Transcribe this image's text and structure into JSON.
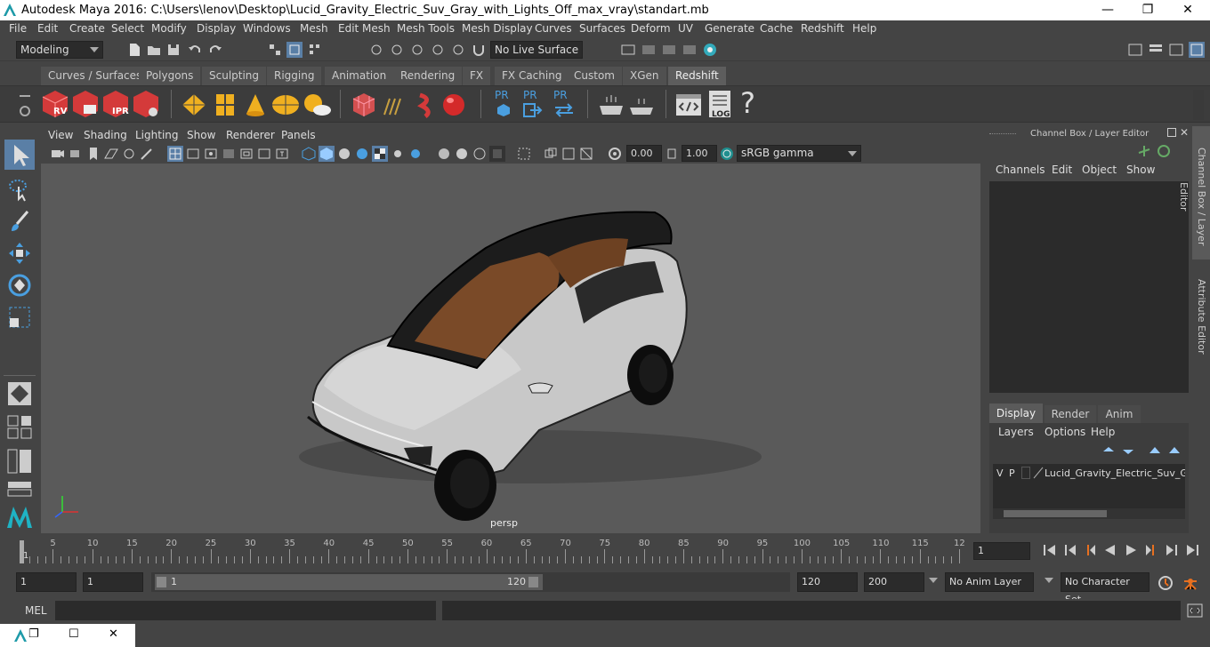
{
  "window": {
    "title": "Autodesk Maya 2016: C:\\Users\\lenov\\Desktop\\Lucid_Gravity_Electric_Suv_Gray_with_Lights_Off_max_vray\\standart.mb",
    "minimize": "—",
    "maximize": "❐",
    "close": "✕"
  },
  "menubar": [
    "File",
    "Edit",
    "Create",
    "Select",
    "Modify",
    "Display",
    "Windows",
    "Mesh",
    "Edit Mesh",
    "Mesh Tools",
    "Mesh Display",
    "Curves",
    "Surfaces",
    "Deform",
    "UV",
    "Generate",
    "Cache",
    "Redshift",
    "Help"
  ],
  "status": {
    "mode": "Modeling",
    "live_surface": "No Live Surface"
  },
  "shelf_tabs": [
    "Curves / Surfaces",
    "Polygons",
    "Sculpting",
    "Rigging",
    "Animation",
    "Rendering",
    "FX",
    "FX Caching",
    "Custom",
    "XGen",
    "Redshift"
  ],
  "shelf_active": "Redshift",
  "shelf_labels": {
    "rv": "RV",
    "ipr": "IPR",
    "pr": "PR",
    "log": "LOG",
    "help": "?"
  },
  "viewport": {
    "menu": [
      "View",
      "Shading",
      "Lighting",
      "Show",
      "Renderer",
      "Panels"
    ],
    "exposure": "0.00",
    "gamma": "1.00",
    "color_space": "sRGB gamma",
    "camera": "persp"
  },
  "channel_box": {
    "title": "Channel Box / Layer Editor",
    "menu": [
      "Channels",
      "Edit",
      "Object",
      "Show"
    ],
    "layer_tabs": [
      "Display",
      "Render",
      "Anim"
    ],
    "active_layer_tab": "Display",
    "layer_menu": [
      "Layers",
      "Options",
      "Help"
    ],
    "layer": {
      "v": "V",
      "p": "P",
      "name": "Lucid_Gravity_Electric_Suv_Gray"
    }
  },
  "side_tabs": [
    "Channel Box / Layer Editor",
    "Attribute Editor"
  ],
  "timeline": {
    "ticks": [
      "5",
      "10",
      "15",
      "20",
      "25",
      "30",
      "35",
      "40",
      "45",
      "50",
      "55",
      "60",
      "65",
      "70",
      "75",
      "80",
      "85",
      "90",
      "95",
      "100",
      "105",
      "110",
      "115",
      "12"
    ],
    "start_marker": "1",
    "current_frame": "1"
  },
  "range": {
    "start": "1",
    "playback_start": "1",
    "slider_start": "1",
    "slider_end": "120",
    "playback_end": "120",
    "end": "200",
    "anim_layer": "No Anim Layer",
    "char_set": "No Character Set"
  },
  "cmd": {
    "label": "MEL"
  }
}
